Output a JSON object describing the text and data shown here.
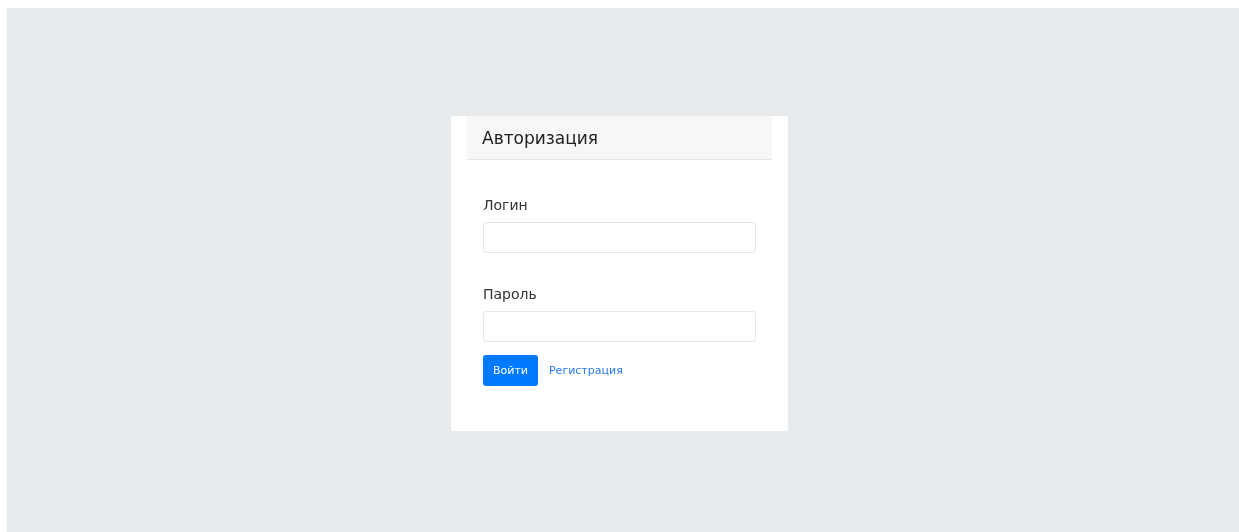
{
  "card": {
    "title": "Авторизация"
  },
  "fields": [
    {
      "label": "Логин"
    },
    {
      "label": "Пароль"
    }
  ],
  "actions": {
    "submit": "Войти",
    "link": "Регистрация"
  }
}
